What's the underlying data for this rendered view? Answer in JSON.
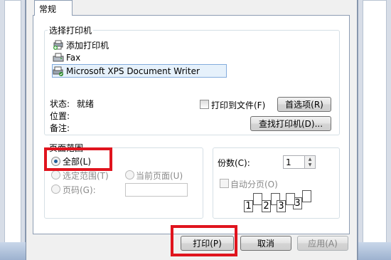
{
  "tab": {
    "label": "常规"
  },
  "printer": {
    "group_title": "选择打印机",
    "items": [
      {
        "label": "添加打印机",
        "icon": "add-printer-icon"
      },
      {
        "label": "Fax",
        "icon": "fax-printer-icon"
      },
      {
        "label": "Microsoft XPS Document Writer",
        "icon": "xps-printer-icon",
        "selected": true
      }
    ],
    "status_label": "状态:",
    "status_value": "就绪",
    "location_label": "位置:",
    "comment_label": "备注:",
    "print_to_file": "打印到文件(F)",
    "preferences_button": "首选项(R)",
    "find_printer_button": "查找打印机(D)..."
  },
  "page_range": {
    "group_title": "页面范围",
    "all": "全部(L)",
    "selection": "选定范围(T)",
    "current_page": "当前页面(U)",
    "pages": "页码(G):",
    "pages_value": ""
  },
  "copies": {
    "label": "份数(C):",
    "value": "1",
    "collate": "自动分页(O)",
    "collate_pages": [
      "1",
      "2",
      "3"
    ]
  },
  "buttons": {
    "print": "打印(P)",
    "cancel": "取消",
    "apply": "应用(A)"
  },
  "colors": {
    "highlight": "#e0141e",
    "selection_bg": "#e6f1fb"
  }
}
